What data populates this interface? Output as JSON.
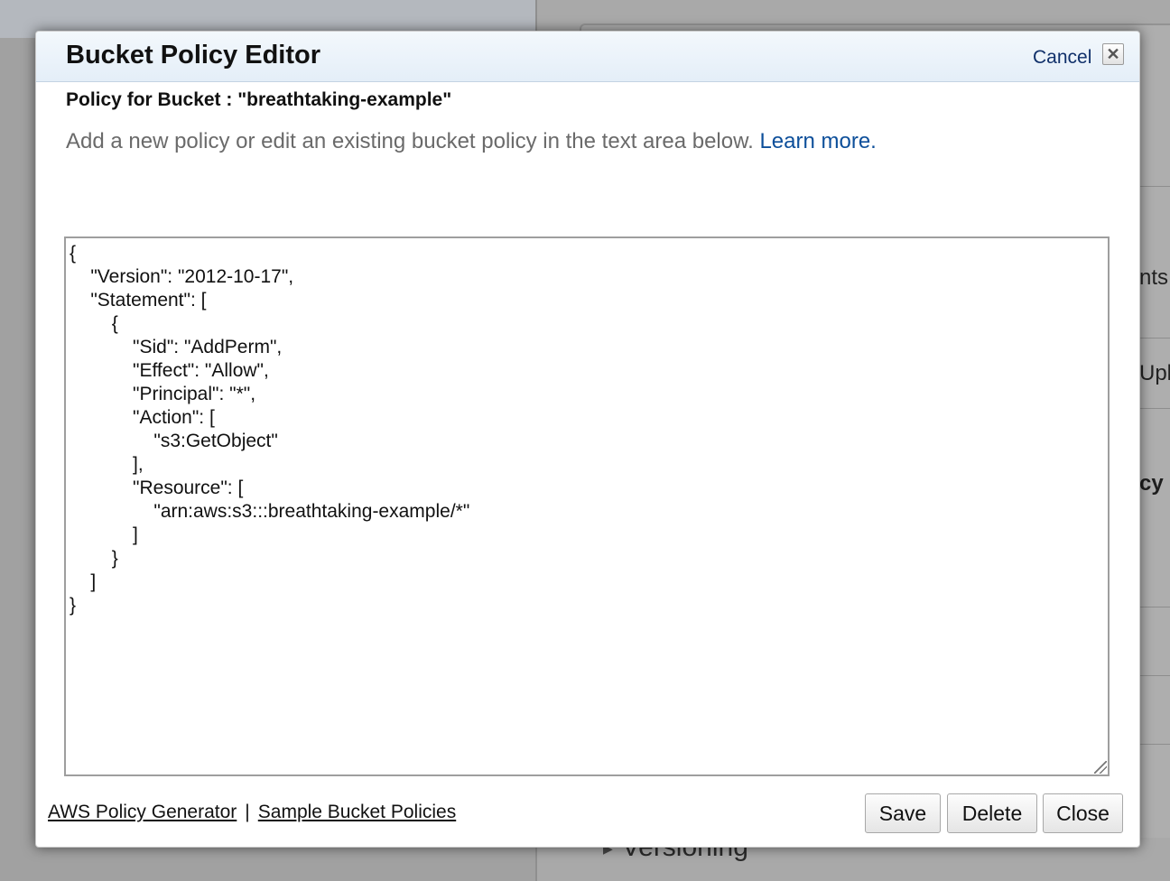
{
  "background": {
    "side_labels": [
      "nts",
      "Upl",
      "cy"
    ],
    "bottom_label": "Versioning"
  },
  "dialog": {
    "title": "Bucket Policy Editor",
    "cancel_label": "Cancel",
    "close_glyph": "✕",
    "policy_heading": "Policy for Bucket : \"breathtaking-example\"",
    "description": "Add a new policy or edit an existing bucket policy in the text area below.",
    "learn_more_label": "Learn more.",
    "policy_text": "{\n\t\"Version\": \"2012-10-17\",\n\t\"Statement\": [\n\t\t{\n\t\t\t\"Sid\": \"AddPerm\",\n\t\t\t\"Effect\": \"Allow\",\n\t\t\t\"Principal\": \"*\",\n\t\t\t\"Action\": [\n\t\t\t\t\"s3:GetObject\"\n\t\t\t],\n\t\t\t\"Resource\": [\n\t\t\t\t\"arn:aws:s3:::breathtaking-example/*\"\n\t\t\t]\n\t\t}\n\t]\n}",
    "footer": {
      "policy_generator_label": "AWS Policy Generator",
      "separator": "|",
      "sample_policies_label": "Sample Bucket Policies"
    },
    "buttons": {
      "save": "Save",
      "delete": "Delete",
      "close": "Close"
    }
  },
  "colors": {
    "link": "#0d4f9a",
    "header_bg": "#e4eef8",
    "overlay": "#9a9a9a"
  }
}
